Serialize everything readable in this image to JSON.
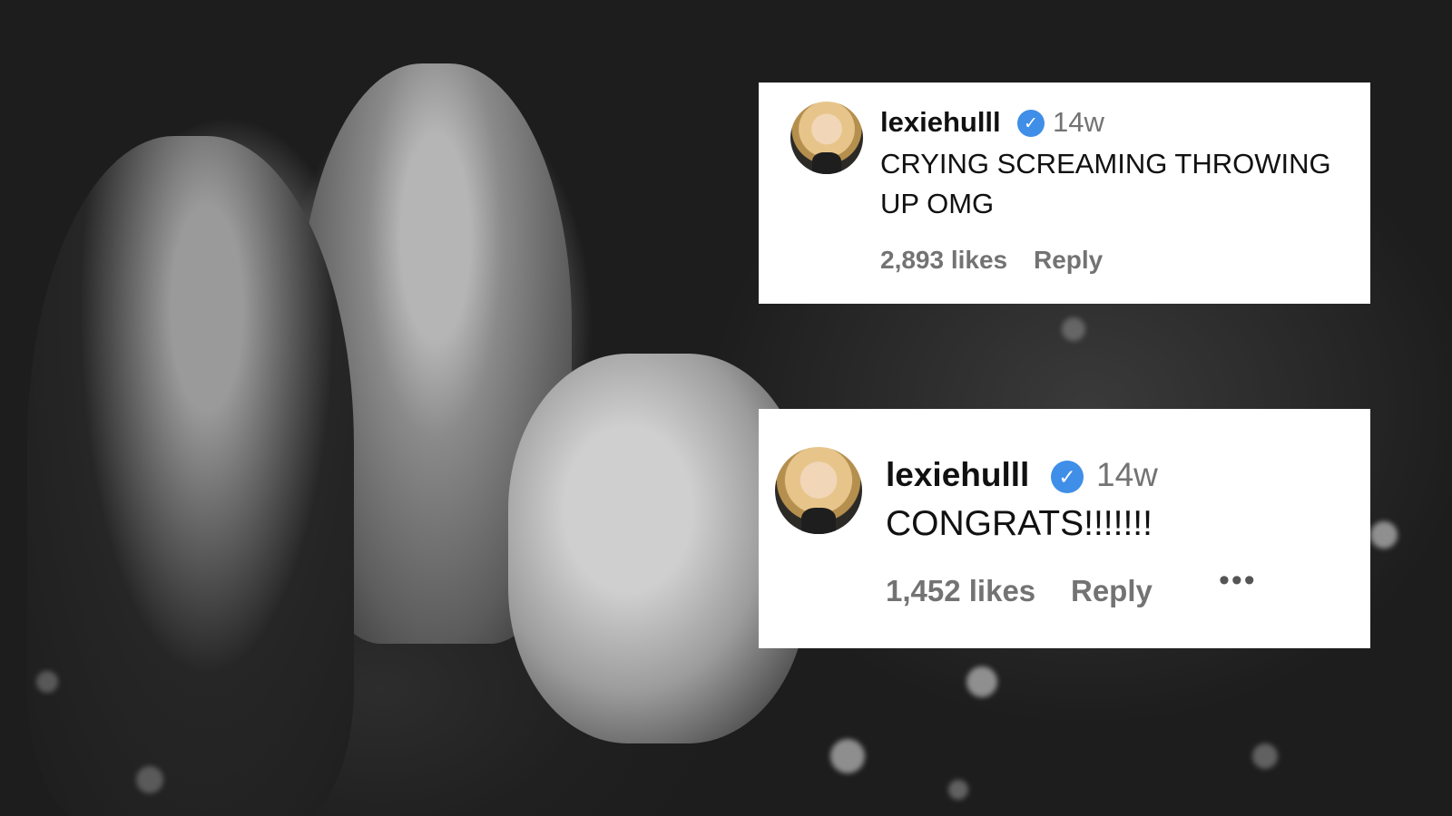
{
  "background": {
    "description_icon": "photo-couple-icon"
  },
  "comments": [
    {
      "username": "lexiehulll",
      "verified_icon": "verified-badge-icon",
      "verified_color": "#3f8ee8",
      "time": "14w",
      "text": "CRYING SCREAMING THROWING UP OMG",
      "likes": "2,893 likes",
      "reply": "Reply"
    },
    {
      "username": "lexiehulll",
      "verified_icon": "verified-badge-icon",
      "verified_color": "#3f8ee8",
      "time": "14w",
      "text": "CONGRATS!!!!!!!",
      "likes": "1,452 likes",
      "reply": "Reply",
      "more": "•••"
    }
  ]
}
